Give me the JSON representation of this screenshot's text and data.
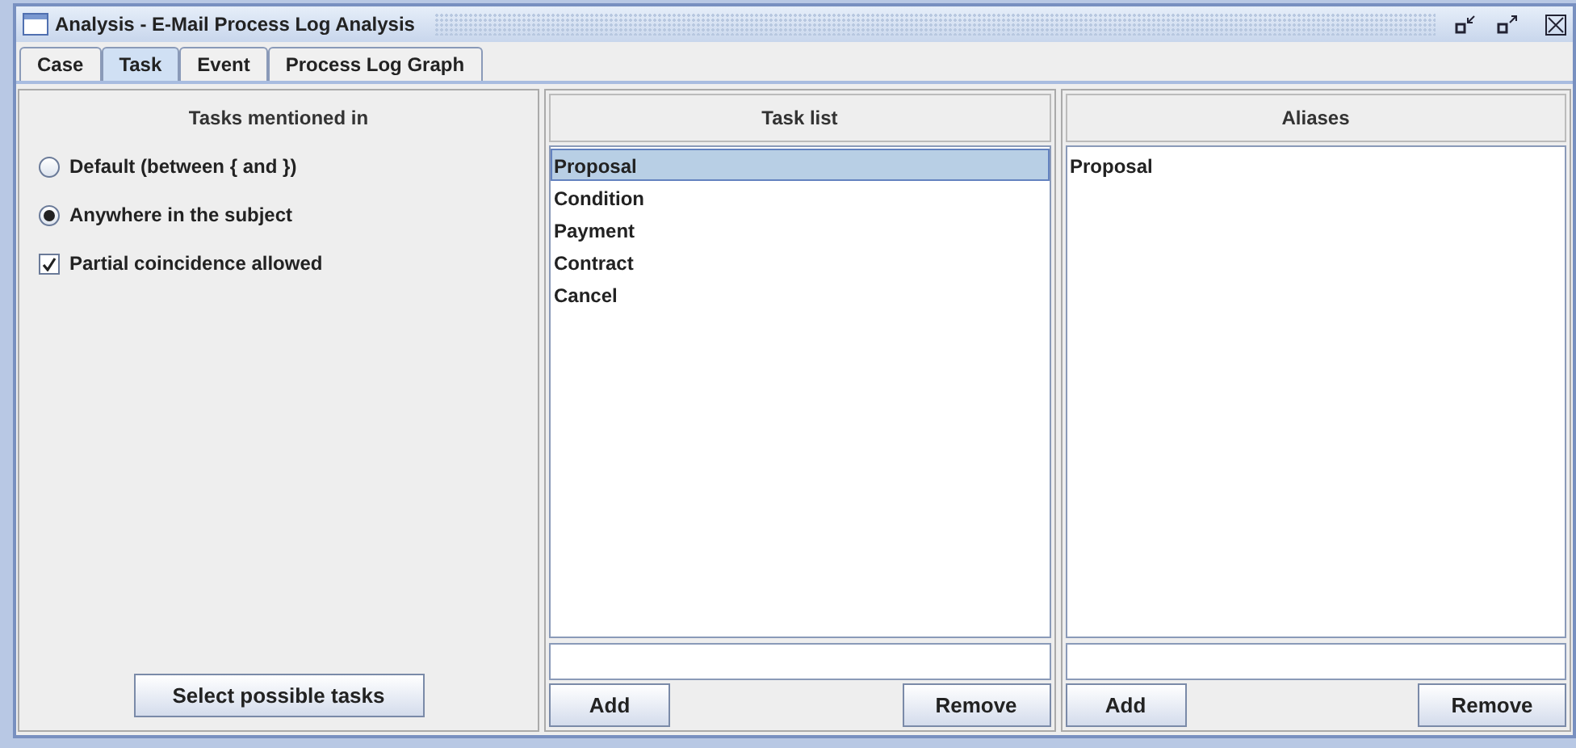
{
  "window": {
    "title": "Analysis - E-Mail Process Log Analysis"
  },
  "tabs": [
    {
      "label": "Case",
      "selected": false
    },
    {
      "label": "Task",
      "selected": true
    },
    {
      "label": "Event",
      "selected": false
    },
    {
      "label": "Process Log Graph",
      "selected": false
    }
  ],
  "options": {
    "title": "Tasks mentioned in",
    "items": [
      {
        "kind": "radio",
        "label": "Default (between { and })",
        "checked": false
      },
      {
        "kind": "radio",
        "label": "Anywhere in the subject",
        "checked": true
      },
      {
        "kind": "checkbox",
        "label": "Partial coincidence allowed",
        "checked": true
      }
    ],
    "button": "Select possible tasks"
  },
  "lists": [
    {
      "title": "Task list",
      "items": [
        {
          "label": "Proposal",
          "selected": true
        },
        {
          "label": "Condition",
          "selected": false
        },
        {
          "label": "Payment",
          "selected": false
        },
        {
          "label": "Contract",
          "selected": false
        },
        {
          "label": "Cancel",
          "selected": false
        }
      ],
      "add": "Add",
      "remove": "Remove"
    },
    {
      "title": "Aliases",
      "items": [
        {
          "label": "Proposal",
          "selected": false
        }
      ],
      "add": "Add",
      "remove": "Remove"
    }
  ]
}
